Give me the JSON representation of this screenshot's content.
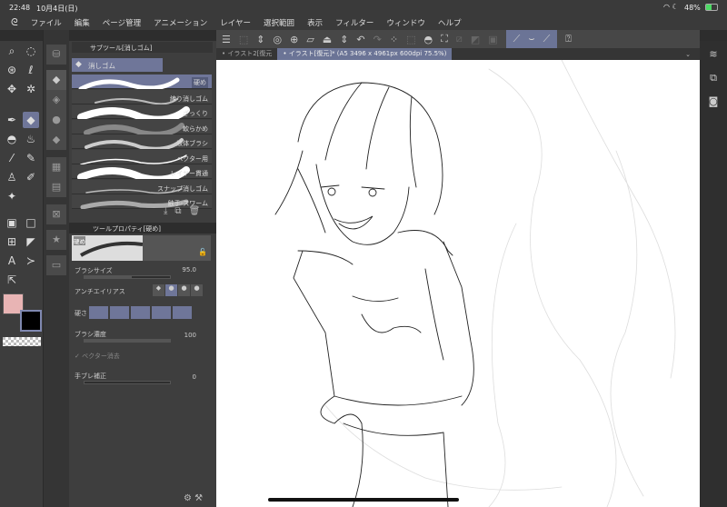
{
  "status": {
    "time": "22:48",
    "date": "10月4日(日)",
    "battery": "48%"
  },
  "menu": [
    "ファイル",
    "編集",
    "ページ管理",
    "アニメーション",
    "レイヤー",
    "選択範囲",
    "表示",
    "フィルター",
    "ウィンドウ",
    "ヘルプ"
  ],
  "subtool": {
    "title": "サブツール[消しゴム]",
    "group": "消しゴム",
    "items": [
      "硬め",
      "練り消しゴム",
      "ざっくり",
      "軟らかめ",
      "液体ブラシ",
      "ベクター用",
      "レイヤー貫通",
      "スナップ消しゴム",
      "触手-スワーム"
    ]
  },
  "toolprop": {
    "title": "ツールプロパティ[硬め]",
    "preview_label": "硬め",
    "brush_size_label": "ブラシサイズ",
    "brush_size": "95.0",
    "brush_size_fill": 0.55,
    "antialias_label": "アンチエイリアス",
    "hardness_label": "硬さ",
    "density_label": "ブラシ濃度",
    "density": "100",
    "density_fill": 1.0,
    "vector_erase_label": "ベクター消去",
    "stabilization_label": "手ブレ補正",
    "stabilization": "0",
    "stabilization_fill": 0.0
  },
  "tabs": [
    "イラスト2[復元",
    "イラスト[復元]* (A5 3496 x 4961px 600dpi 75.5%)"
  ],
  "colors": {
    "main": "#e8b4b4",
    "sub": "#000000",
    "accent": "#6f7699"
  }
}
